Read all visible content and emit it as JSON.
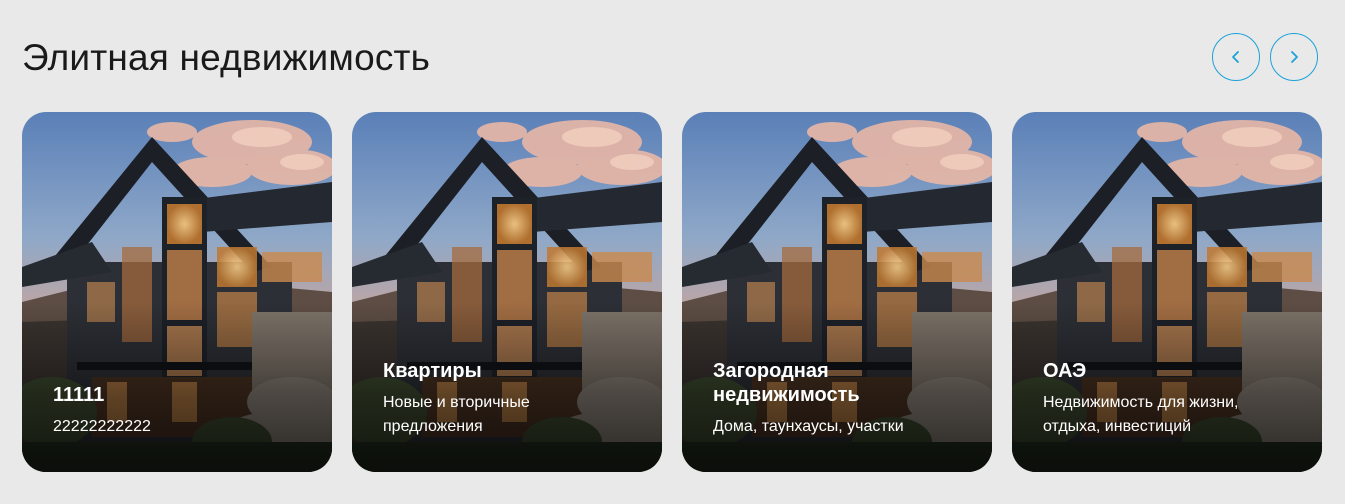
{
  "section": {
    "title": "Элитная недвижимость",
    "prev_icon": "chevron-left-icon",
    "next_icon": "chevron-right-icon",
    "accent_color": "#1ba2d9"
  },
  "cards": [
    {
      "title": "11111",
      "subtitle": "22222222222"
    },
    {
      "title": "Квартиры",
      "subtitle": "Новые и вторичные предложения"
    },
    {
      "title": "Загородная недвижимость",
      "subtitle": "Дома, таунхаусы, участки"
    },
    {
      "title": "ОАЭ",
      "subtitle": "Недвижимость для жизни, отдыха, инвестиций"
    }
  ]
}
